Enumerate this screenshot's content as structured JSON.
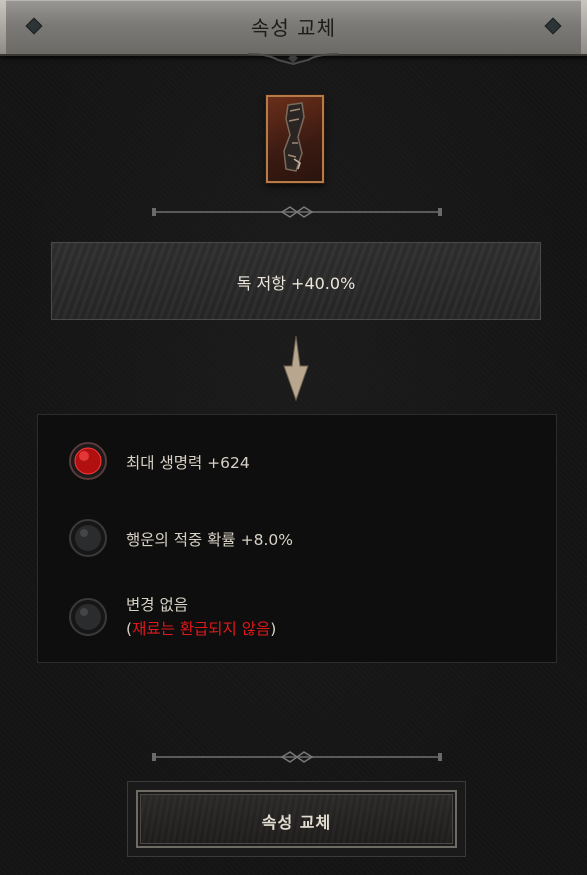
{
  "window": {
    "title": "속성 교체"
  },
  "item": {
    "icon": "gloves-item-icon",
    "frame_color": "#b57c4a"
  },
  "current_affix": {
    "text": "독 저항 +40.0%"
  },
  "options": [
    {
      "label": "최대 생명력 +624",
      "gem": "red",
      "selected": true
    },
    {
      "label": "행운의 적중 확률 +8.0%",
      "gem": "dark",
      "selected": false
    },
    {
      "label": "변경 없음",
      "gem": "dark",
      "selected": false,
      "note_open": "(",
      "note_red": "재료는 환급되지 않음",
      "note_close": ")"
    }
  ],
  "button": {
    "label": "속성 교체"
  },
  "colors": {
    "accent_red": "#e01818",
    "text": "#d8d2c6",
    "arrow": "#b8a68e"
  }
}
